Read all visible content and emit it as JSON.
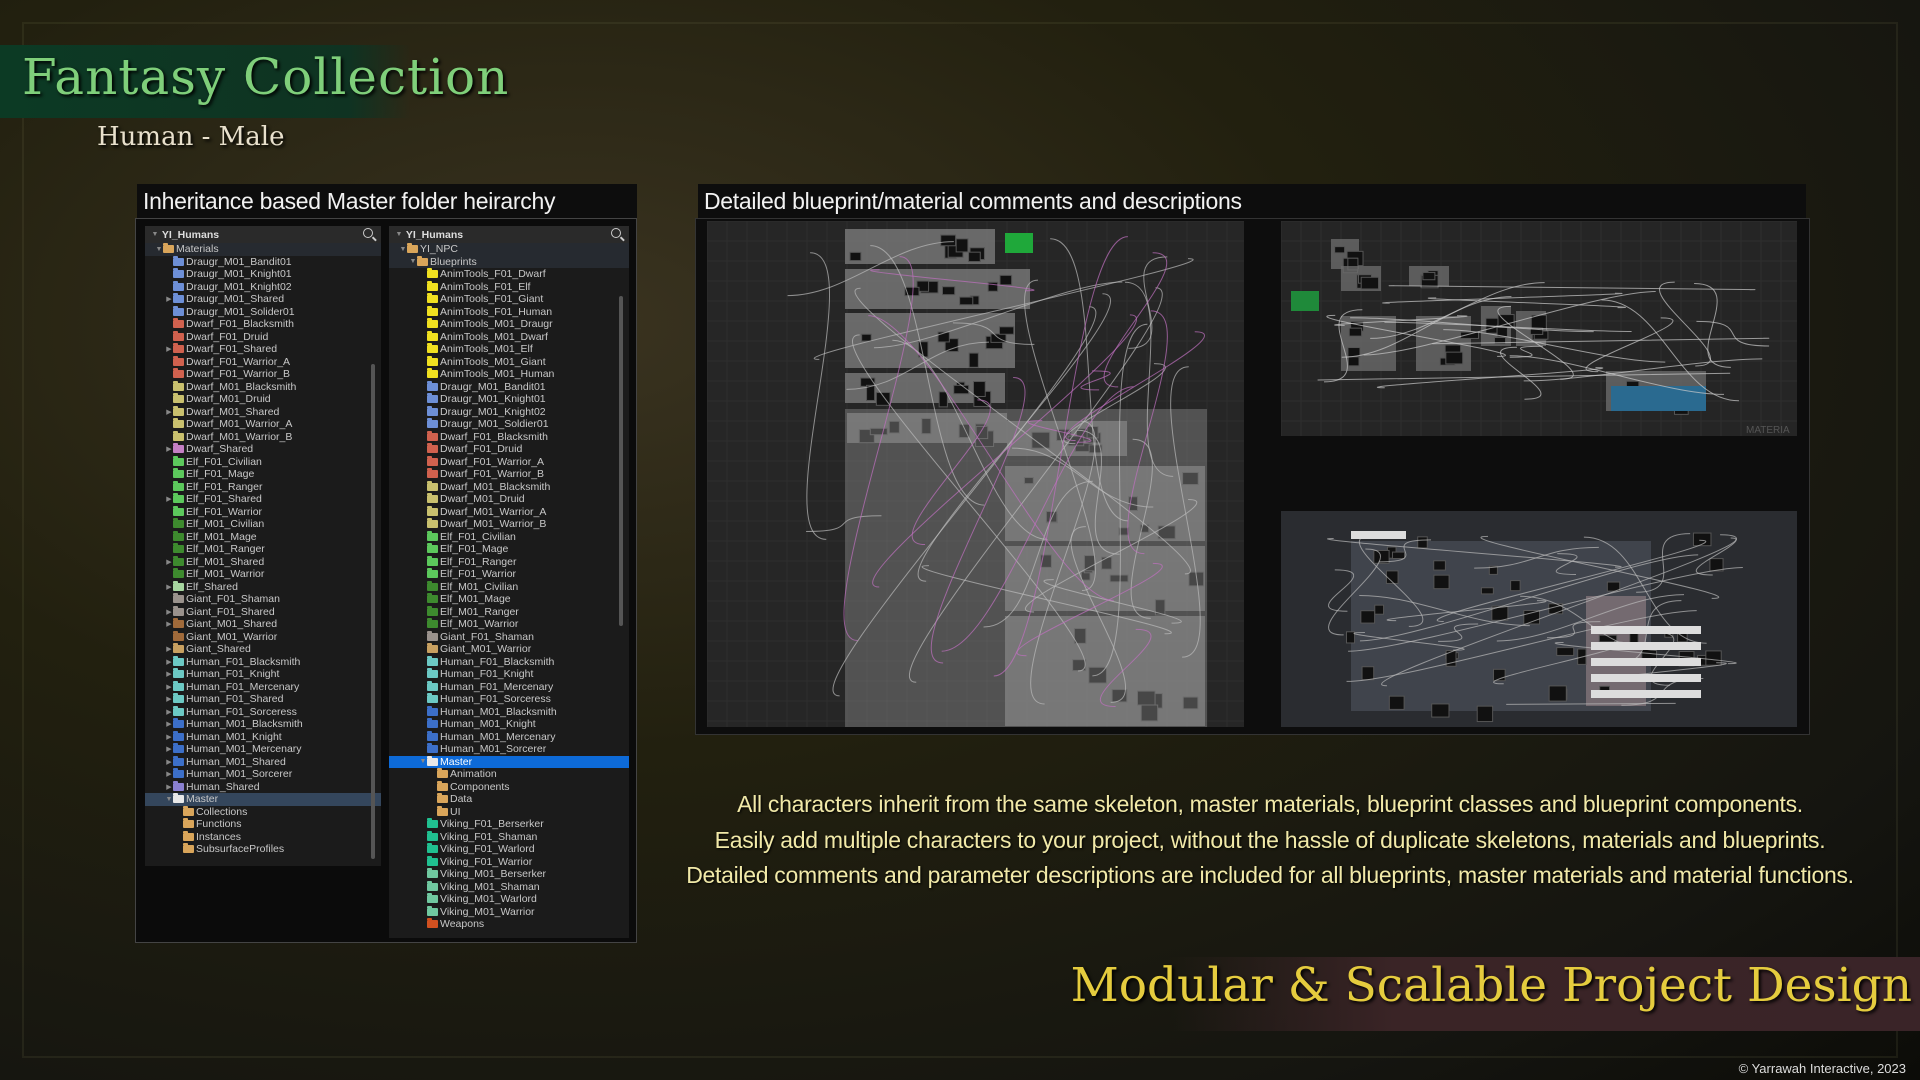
{
  "header": {
    "title": "Fantasy Collection",
    "subtitle": "Human - Male"
  },
  "left_section": {
    "label": "Inheritance based Master folder heirarchy",
    "tree1": {
      "root": "YI_Humans",
      "items": [
        [
          "Materials",
          "#d9a55a",
          0,
          1,
          "open"
        ],
        [
          "Draugr_M01_Bandit01",
          "#6d8fd6",
          0,
          2
        ],
        [
          "Draugr_M01_Knight01",
          "#6d8fd6",
          0,
          2
        ],
        [
          "Draugr_M01_Knight02",
          "#6d8fd6",
          0,
          2
        ],
        [
          "Draugr_M01_Shared",
          "#6d8fd6",
          1,
          2
        ],
        [
          "Draugr_M01_Solider01",
          "#6d8fd6",
          0,
          2
        ],
        [
          "Dwarf_F01_Blacksmith",
          "#d0614e",
          0,
          2
        ],
        [
          "Dwarf_F01_Druid",
          "#d0614e",
          0,
          2
        ],
        [
          "Dwarf_F01_Shared",
          "#d0614e",
          1,
          2
        ],
        [
          "Dwarf_F01_Warrior_A",
          "#d0614e",
          0,
          2
        ],
        [
          "Dwarf_F01_Warrior_B",
          "#d0614e",
          0,
          2
        ],
        [
          "Dwarf_M01_Blacksmith",
          "#c9c06e",
          0,
          2
        ],
        [
          "Dwarf_M01_Druid",
          "#c9c06e",
          0,
          2
        ],
        [
          "Dwarf_M01_Shared",
          "#c9c06e",
          1,
          2
        ],
        [
          "Dwarf_M01_Warrior_A",
          "#c9c06e",
          0,
          2
        ],
        [
          "Dwarf_M01_Warrior_B",
          "#c9c06e",
          0,
          2
        ],
        [
          "Dwarf_Shared",
          "#c47fc4",
          1,
          2
        ],
        [
          "Elf_F01_Civilian",
          "#5cc85c",
          0,
          2
        ],
        [
          "Elf_F01_Mage",
          "#5cc85c",
          0,
          2
        ],
        [
          "Elf_F01_Ranger",
          "#5cc85c",
          0,
          2
        ],
        [
          "Elf_F01_Shared",
          "#5cc85c",
          1,
          2
        ],
        [
          "Elf_F01_Warrior",
          "#5cc85c",
          0,
          2
        ],
        [
          "Elf_M01_Civilian",
          "#3d8a2e",
          0,
          2
        ],
        [
          "Elf_M01_Mage",
          "#3d8a2e",
          0,
          2
        ],
        [
          "Elf_M01_Ranger",
          "#3d8a2e",
          0,
          2
        ],
        [
          "Elf_M01_Shared",
          "#3d8a2e",
          1,
          2
        ],
        [
          "Elf_M01_Warrior",
          "#3d8a2e",
          0,
          2
        ],
        [
          "Elf_Shared",
          "#a7d6a0",
          1,
          2
        ],
        [
          "Giant_F01_Shaman",
          "#9a928c",
          0,
          2
        ],
        [
          "Giant_F01_Shared",
          "#9a928c",
          1,
          2
        ],
        [
          "Giant_M01_Shared",
          "#a06a3a",
          1,
          2
        ],
        [
          "Giant_M01_Warrior",
          "#a06a3a",
          0,
          2
        ],
        [
          "Giant_Shared",
          "#c8a060",
          1,
          2
        ],
        [
          "Human_F01_Blacksmith",
          "#6cc9c4",
          1,
          2
        ],
        [
          "Human_F01_Knight",
          "#6cc9c4",
          1,
          2
        ],
        [
          "Human_F01_Mercenary",
          "#6cc9c4",
          1,
          2
        ],
        [
          "Human_F01_Shared",
          "#6cc9c4",
          1,
          2
        ],
        [
          "Human_F01_Sorceress",
          "#6cc9c4",
          1,
          2
        ],
        [
          "Human_M01_Blacksmith",
          "#3c6fc8",
          1,
          2
        ],
        [
          "Human_M01_Knight",
          "#3c6fc8",
          1,
          2
        ],
        [
          "Human_M01_Mercenary",
          "#3c6fc8",
          1,
          2
        ],
        [
          "Human_M01_Shared",
          "#3c6fc8",
          1,
          2
        ],
        [
          "Human_M01_Sorcerer",
          "#3c6fc8",
          1,
          2
        ],
        [
          "Human_Shared",
          "#8a80d0",
          1,
          2
        ],
        [
          "Master",
          "#e8e8e8",
          0,
          2,
          "selected"
        ],
        [
          "Collections",
          "#d9a55a",
          0,
          3
        ],
        [
          "Functions",
          "#d9a55a",
          0,
          3
        ],
        [
          "Instances",
          "#d9a55a",
          0,
          3
        ],
        [
          "SubsurfaceProfiles",
          "#d9a55a",
          0,
          3
        ]
      ]
    },
    "tree2": {
      "root": "YI_Humans",
      "items": [
        [
          "YI_NPC",
          "#d9a55a",
          0,
          1,
          "open"
        ],
        [
          "Blueprints",
          "#d9a55a",
          0,
          2,
          "open"
        ],
        [
          "AnimTools_F01_Dwarf",
          "#f0e020",
          0,
          3
        ],
        [
          "AnimTools_F01_Elf",
          "#f0e020",
          0,
          3
        ],
        [
          "AnimTools_F01_Giant",
          "#f0e020",
          0,
          3
        ],
        [
          "AnimTools_F01_Human",
          "#f0e020",
          0,
          3
        ],
        [
          "AnimTools_M01_Draugr",
          "#f0e020",
          0,
          3
        ],
        [
          "AnimTools_M01_Dwarf",
          "#f0e020",
          0,
          3
        ],
        [
          "AnimTools_M01_Elf",
          "#f0e020",
          0,
          3
        ],
        [
          "AnimTools_M01_Giant",
          "#f0e020",
          0,
          3
        ],
        [
          "AnimTools_M01_Human",
          "#f0e020",
          0,
          3
        ],
        [
          "Draugr_M01_Bandit01",
          "#6d8fd6",
          0,
          3
        ],
        [
          "Draugr_M01_Knight01",
          "#6d8fd6",
          0,
          3
        ],
        [
          "Draugr_M01_Knight02",
          "#6d8fd6",
          0,
          3
        ],
        [
          "Draugr_M01_Soldier01",
          "#6d8fd6",
          0,
          3
        ],
        [
          "Dwarf_F01_Blacksmith",
          "#d0614e",
          0,
          3
        ],
        [
          "Dwarf_F01_Druid",
          "#d0614e",
          0,
          3
        ],
        [
          "Dwarf_F01_Warrior_A",
          "#d0614e",
          0,
          3
        ],
        [
          "Dwarf_F01_Warrior_B",
          "#d0614e",
          0,
          3
        ],
        [
          "Dwarf_M01_Blacksmith",
          "#c9c06e",
          0,
          3
        ],
        [
          "Dwarf_M01_Druid",
          "#c9c06e",
          0,
          3
        ],
        [
          "Dwarf_M01_Warrior_A",
          "#c9c06e",
          0,
          3
        ],
        [
          "Dwarf_M01_Warrior_B",
          "#c9c06e",
          0,
          3
        ],
        [
          "Elf_F01_Civilian",
          "#5cc85c",
          0,
          3
        ],
        [
          "Elf_F01_Mage",
          "#5cc85c",
          0,
          3
        ],
        [
          "Elf_F01_Ranger",
          "#5cc85c",
          0,
          3
        ],
        [
          "Elf_F01_Warrior",
          "#5cc85c",
          0,
          3
        ],
        [
          "Elf_M01_Civilian",
          "#3d8a2e",
          0,
          3
        ],
        [
          "Elf_M01_Mage",
          "#3d8a2e",
          0,
          3
        ],
        [
          "Elf_M01_Ranger",
          "#3d8a2e",
          0,
          3
        ],
        [
          "Elf_M01_Warrior",
          "#3d8a2e",
          0,
          3
        ],
        [
          "Giant_F01_Shaman",
          "#9a928c",
          0,
          3
        ],
        [
          "Giant_M01_Warrior",
          "#c8a060",
          0,
          3
        ],
        [
          "Human_F01_Blacksmith",
          "#6cc9c4",
          0,
          3
        ],
        [
          "Human_F01_Knight",
          "#6cc9c4",
          0,
          3
        ],
        [
          "Human_F01_Mercenary",
          "#6cc9c4",
          0,
          3
        ],
        [
          "Human_F01_Sorceress",
          "#6cc9c4",
          0,
          3
        ],
        [
          "Human_M01_Blacksmith",
          "#3c6fc8",
          0,
          3
        ],
        [
          "Human_M01_Knight",
          "#3c6fc8",
          0,
          3
        ],
        [
          "Human_M01_Mercenary",
          "#3c6fc8",
          0,
          3
        ],
        [
          "Human_M01_Sorcerer",
          "#3c6fc8",
          0,
          3
        ],
        [
          "Master",
          "#e8e8e8",
          0,
          3,
          "selected2"
        ],
        [
          "Animation",
          "#d9a55a",
          0,
          4
        ],
        [
          "Components",
          "#d9a55a",
          0,
          4
        ],
        [
          "Data",
          "#d9a55a",
          0,
          4
        ],
        [
          "UI",
          "#d9a55a",
          0,
          4
        ],
        [
          "Viking_F01_Berserker",
          "#20c090",
          0,
          3
        ],
        [
          "Viking_F01_Shaman",
          "#20c090",
          0,
          3
        ],
        [
          "Viking_F01_Warlord",
          "#20c090",
          0,
          3
        ],
        [
          "Viking_F01_Warrior",
          "#20c090",
          0,
          3
        ],
        [
          "Viking_M01_Berserker",
          "#70c8a0",
          0,
          3
        ],
        [
          "Viking_M01_Shaman",
          "#70c8a0",
          0,
          3
        ],
        [
          "Viking_M01_Warlord",
          "#70c8a0",
          0,
          3
        ],
        [
          "Viking_M01_Warrior",
          "#70c8a0",
          0,
          3
        ],
        [
          "Weapons",
          "#d05020",
          0,
          3
        ]
      ]
    }
  },
  "right_section": {
    "label": "Detailed blueprint/material comments and descriptions",
    "graph2_watermark": "MATERIA"
  },
  "description": [
    "All characters inherit from the same skeleton, master materials, blueprint classes and blueprint components.",
    "Easily add multiple characters to your project, without the hassle of duplicate skeletons, materials and blueprints.",
    "Detailed comments and parameter descriptions are included for all blueprints, master materials and material functions."
  ],
  "footer": {
    "tagline": "Modular & Scalable Project Design",
    "copyright": "© Yarrawah Interactive, 2023"
  },
  "colors": {
    "title": "#7fcf7a",
    "tagline": "#e5cc3e",
    "description": "#f1e9a8",
    "selection": "#0d6ad8"
  }
}
